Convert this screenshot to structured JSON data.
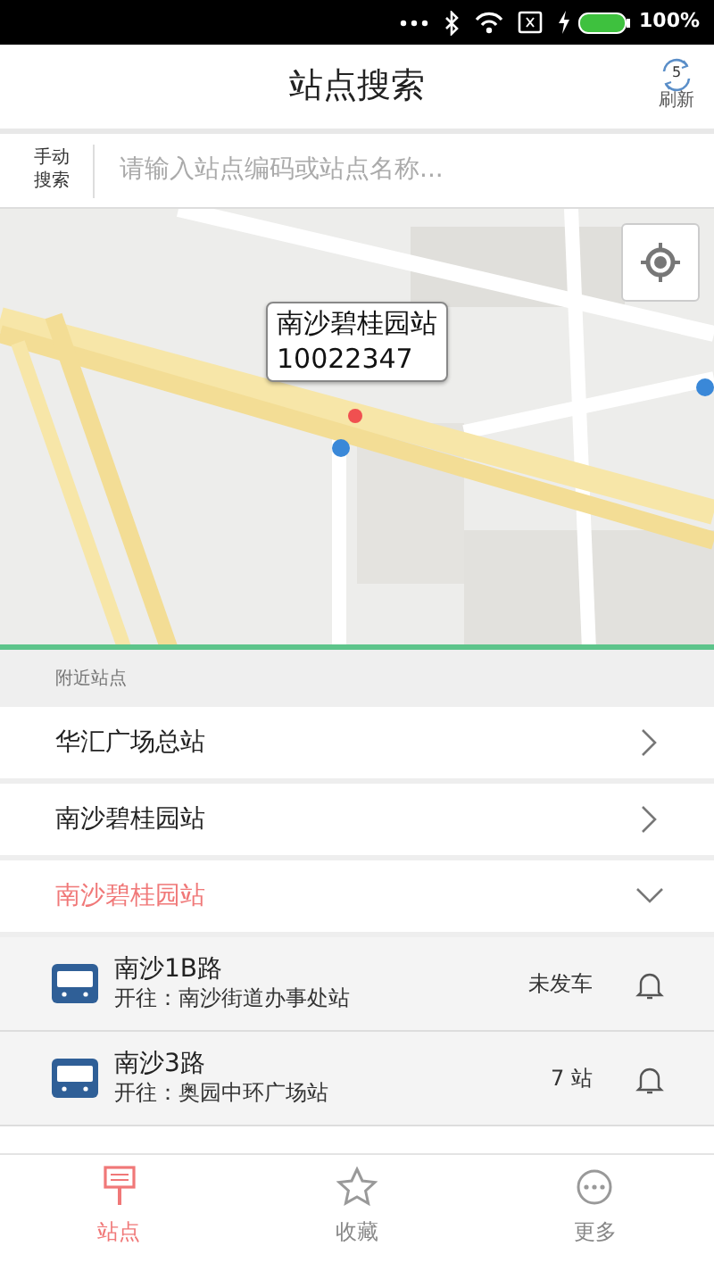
{
  "status_bar": {
    "battery": "100%"
  },
  "header": {
    "title": "站点搜索",
    "refresh": {
      "count": "5",
      "label": "刷新"
    }
  },
  "search": {
    "mode_label": "手动搜索",
    "placeholder": "请输入站点编码或站点名称..."
  },
  "map": {
    "kind": "picture",
    "callout": {
      "name": "南沙碧桂园站",
      "code": "10022347"
    }
  },
  "nearby": {
    "heading": "附近站点",
    "stations": [
      {
        "name": "华汇广场总站",
        "expanded": false
      },
      {
        "name": "南沙碧桂园站",
        "expanded": false
      },
      {
        "name": "南沙碧桂园站",
        "expanded": true,
        "routes": [
          {
            "name": "南沙1B路",
            "towards": "开往：南沙街道办事处站",
            "status": "未发车"
          },
          {
            "name": "南沙3路",
            "towards": "开往：奥园中环广场站",
            "status": "7 站"
          }
        ]
      }
    ]
  },
  "tabs": [
    {
      "label": "站点",
      "selected": true
    },
    {
      "label": "收藏",
      "selected": false
    },
    {
      "label": "更多",
      "selected": false
    }
  ]
}
